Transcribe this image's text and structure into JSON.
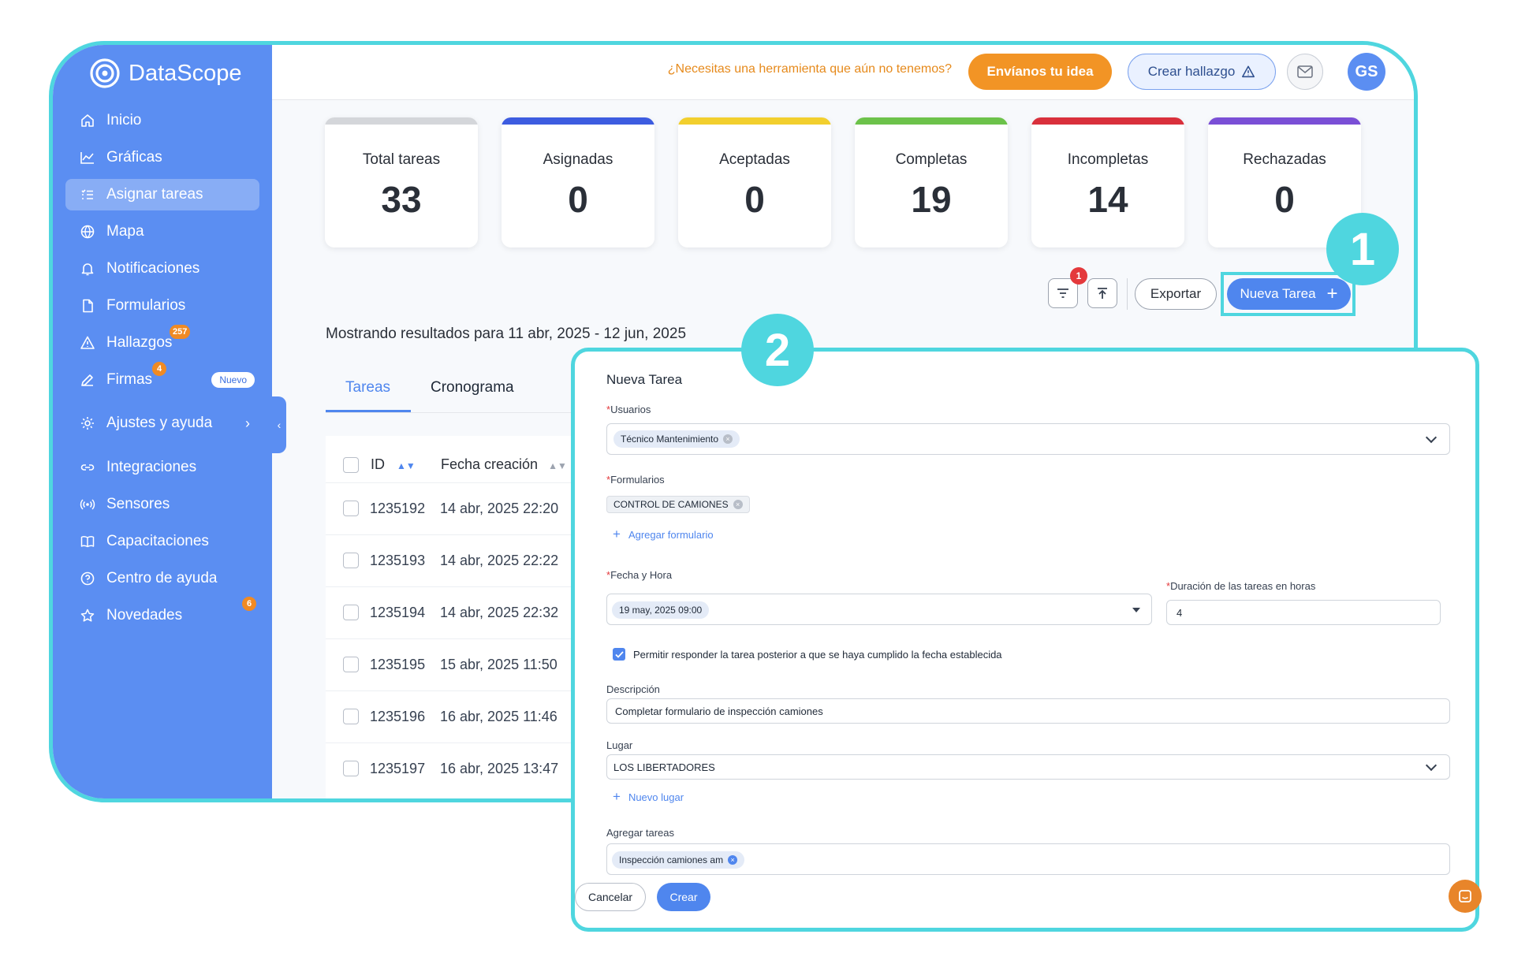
{
  "colors": {
    "accent": "#4f86ee",
    "sidebar": "#5b8ef2",
    "highlight": "#4fd6df",
    "orange": "#f29425",
    "badge_red": "#e4393c"
  },
  "brand": {
    "name": "DataScope",
    "icon": "datascope-logo-icon"
  },
  "sidebar": {
    "items": [
      {
        "label": "Inicio",
        "icon": "home-icon"
      },
      {
        "label": "Gráficas",
        "icon": "chart-line-icon"
      },
      {
        "label": "Asignar tareas",
        "icon": "task-list-icon",
        "active": true
      },
      {
        "label": "Mapa",
        "icon": "globe-icon"
      },
      {
        "label": "Notificaciones",
        "icon": "bell-icon"
      },
      {
        "label": "Formularios",
        "icon": "document-icon"
      },
      {
        "label": "Hallazgos",
        "icon": "warning-icon",
        "badge": "257"
      },
      {
        "label": "Firmas",
        "icon": "pen-icon",
        "badge": "4",
        "tag": "Nuevo"
      },
      {
        "label": "Ajustes y ayuda",
        "icon": "gear-icon"
      },
      {
        "label": "Integraciones",
        "icon": "link-icon"
      },
      {
        "label": "Sensores",
        "icon": "sensor-icon"
      },
      {
        "label": "Capacitaciones",
        "icon": "book-icon"
      },
      {
        "label": "Centro de ayuda",
        "icon": "help-icon"
      },
      {
        "label": "Novedades",
        "icon": "star-icon",
        "badge": "6"
      }
    ]
  },
  "header": {
    "prompt": "¿Necesitas una herramienta que aún no tenemos?",
    "idea_button": "Envíanos tu idea",
    "finding_button": "Crear hallazgo",
    "avatar": "GS"
  },
  "stats": [
    {
      "label": "Total tareas",
      "value": "33",
      "color": "#d4d6da"
    },
    {
      "label": "Asignadas",
      "value": "0",
      "color": "#3d5ce0"
    },
    {
      "label": "Aceptadas",
      "value": "0",
      "color": "#f2cf2e"
    },
    {
      "label": "Completas",
      "value": "19",
      "color": "#6cc24a"
    },
    {
      "label": "Incompletas",
      "value": "14",
      "color": "#d9303c"
    },
    {
      "label": "Rechazadas",
      "value": "0",
      "color": "#7a4fd6"
    }
  ],
  "toolbar": {
    "filter_count": "1",
    "export": "Exportar",
    "new_task": "Nueva Tarea"
  },
  "results": "Mostrando resultados para 11 abr, 2025 - 12 jun, 2025",
  "tabs": [
    "Tareas",
    "Cronograma"
  ],
  "table": {
    "headers": [
      "ID",
      "Fecha creación"
    ],
    "rows": [
      {
        "id": "1235192",
        "fecha": "14 abr, 2025 22:20"
      },
      {
        "id": "1235193",
        "fecha": "14 abr, 2025 22:22"
      },
      {
        "id": "1235194",
        "fecha": "14 abr, 2025 22:32"
      },
      {
        "id": "1235195",
        "fecha": "15 abr, 2025 11:50"
      },
      {
        "id": "1235196",
        "fecha": "16 abr, 2025 11:46"
      },
      {
        "id": "1235197",
        "fecha": "16 abr, 2025 13:47"
      }
    ]
  },
  "callouts": [
    "1",
    "2"
  ],
  "modal": {
    "title": "Nueva Tarea",
    "users_label": "Usuarios",
    "users_value": "Técnico Mantenimiento",
    "forms_label": "Formularios",
    "forms_value": "CONTROL DE CAMIONES",
    "add_form": "Agregar formulario",
    "datetime_label": "Fecha y Hora",
    "datetime_value": "19 may, 2025 09:00",
    "duration_label": "Duración de las tareas en horas",
    "duration_value": "4",
    "allow_late": "Permitir responder la tarea posterior a que se haya cumplido la fecha establecida",
    "allow_late_checked": true,
    "description_label": "Descripción",
    "description_value": "Completar formulario de inspección camiones",
    "place_label": "Lugar",
    "place_value": "LOS LIBERTADORES",
    "new_place": "Nuevo lugar",
    "add_tasks_label": "Agregar tareas",
    "add_tasks_value": "Inspección camiones am",
    "cancel": "Cancelar",
    "create": "Crear"
  }
}
